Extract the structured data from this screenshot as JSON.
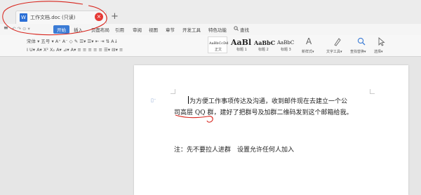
{
  "tab": {
    "icon": "W",
    "title": "工作文档.doc (只读)",
    "close": "×",
    "new": "+"
  },
  "menu": {
    "file_icon": "≡",
    "quick": "↶ ↷ ⊙ ▾",
    "items": [
      "开始",
      "插入",
      "页面布局",
      "引用",
      "审阅",
      "视图",
      "章节",
      "开发工具",
      "特色功能"
    ],
    "search": "查找"
  },
  "ribbon": {
    "row1": "宋体  ▾  五号  ▾  A⁺ A⁻ ◇  ✎   ☰▾ ☰▾ ⇤ ⇥  ⇅  A↓",
    "row2": "I  U▾  A▾  X² X₂  A▾  ⊿▾  A▾   ≡ ≡ ≡ ≡ ≡  ☰▾  ⊟▾  ≡",
    "styles": [
      {
        "big": "AaBbCcDd",
        "cap": "正文"
      },
      {
        "big": "AaBl",
        "cap": "标题 1"
      },
      {
        "big": "AaBbC",
        "cap": "标题 2"
      },
      {
        "big": "AaBbC",
        "cap": "标题 3"
      }
    ],
    "new_style": "新样式▾",
    "text_tool": "文字工具▾",
    "find_replace": "查找替换▾",
    "select": "选择▾"
  },
  "document": {
    "line1": "为方便工作事项传达及沟通，收到邮件现在去建立一个公",
    "line2": "司高层 QQ 群，建好了把群号及加群二维码发到这个邮箱给我。",
    "note": "注：先不要拉人进群　设置允许任何人加入"
  },
  "colors": {
    "accent": "#3a7bd5",
    "annotation": "#d8241c"
  }
}
